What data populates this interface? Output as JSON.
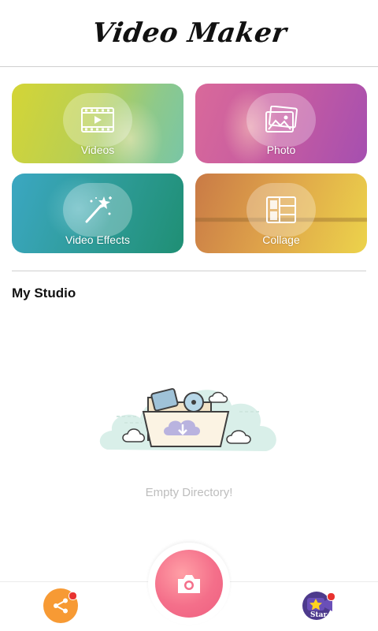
{
  "header": {
    "title": "Video Maker"
  },
  "tiles": [
    {
      "label": "Videos",
      "icon": "video-film-icon"
    },
    {
      "label": "Photo",
      "icon": "photo-gallery-icon"
    },
    {
      "label": "Video Effects",
      "icon": "magic-wand-icon"
    },
    {
      "label": "Collage",
      "icon": "collage-grid-icon"
    }
  ],
  "studio": {
    "title": "My Studio",
    "empty_message": "Empty Directory!",
    "illustration": "empty-folder-cloud-icon"
  },
  "bottom_bar": {
    "share_icon": "share-icon",
    "camera_icon": "camera-icon",
    "star_label": "Star"
  },
  "colors": {
    "camera_button": "#f46f8a",
    "share_button": "#f79a34",
    "badge": "#e8322f",
    "empty_text": "#bdbdbd"
  }
}
